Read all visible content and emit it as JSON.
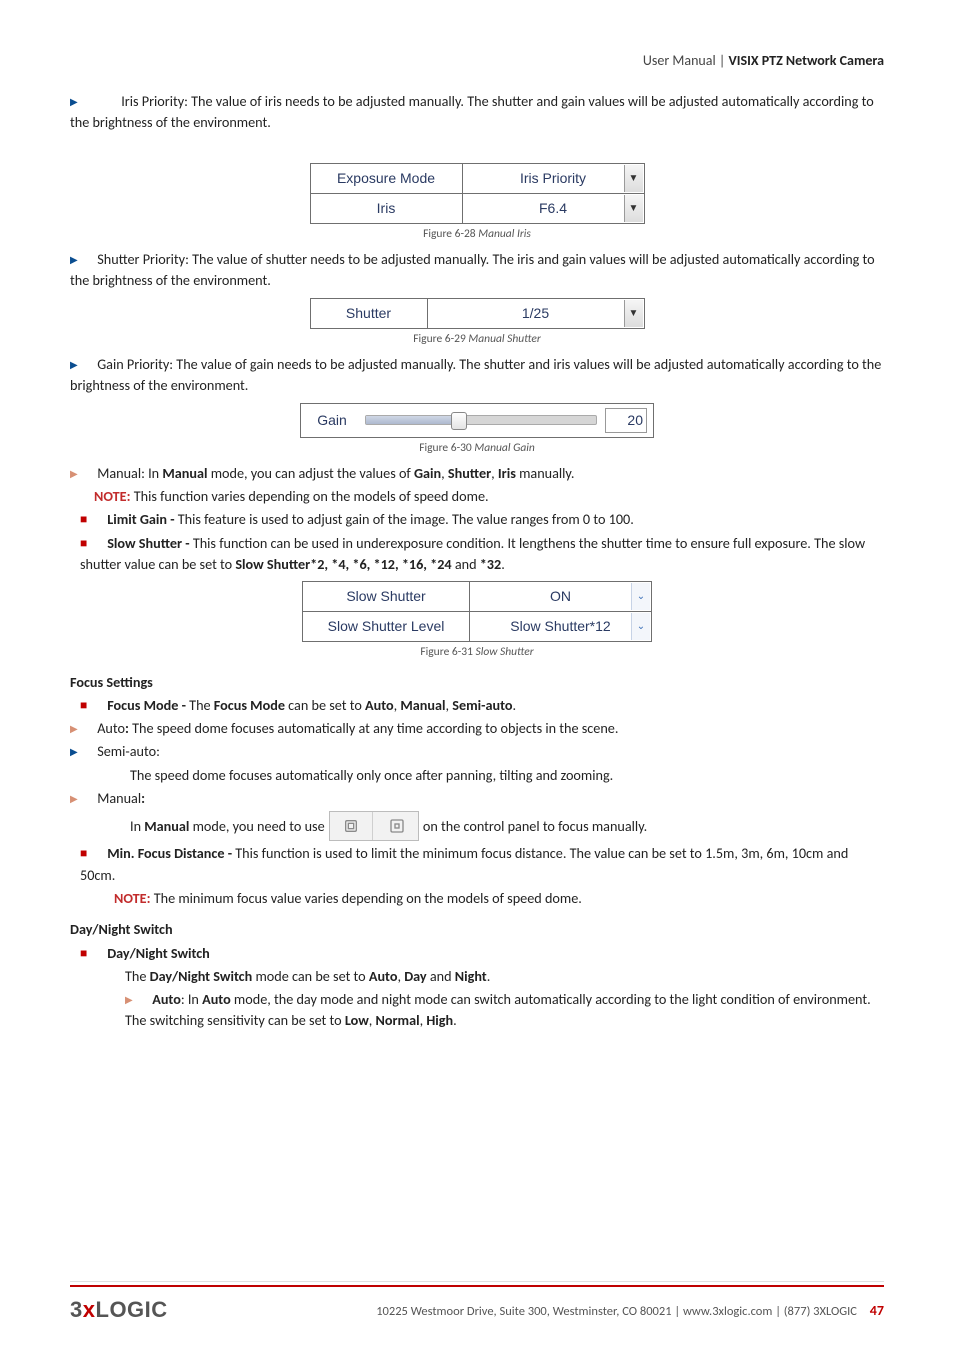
{
  "header": {
    "left": "User Manual",
    "sep": " | ",
    "right": "VISIX PTZ Network Camera"
  },
  "iris_priority": {
    "intro": "Iris Priority: The value of iris needs to be adjusted manually. The shutter and gain values will be adjusted automatically according to the brightness of the environment.",
    "row1_label": "Exposure Mode",
    "row1_value": "Iris Priority",
    "row2_label": "Iris",
    "row2_value": "F6.4",
    "caption_prefix": "Figure 6-28  ",
    "caption_ital": "Manual Iris"
  },
  "shutter_priority": {
    "intro": "Shutter Priority: The value of shutter needs to be adjusted manually. The iris and gain values will be adjusted automatically according to the brightness of the environment.",
    "row1_label": "Shutter",
    "row1_value": "1/25",
    "caption_prefix": "Figure 6-29  ",
    "caption_ital": "Manual Shutter"
  },
  "gain_priority": {
    "intro": "Gain Priority: The value of gain needs to be adjusted manually. The shutter and iris values will be adjusted automatically according to the brightness of the environment.",
    "slider_label": "Gain",
    "slider_value": "20",
    "caption_prefix": "Figure 6-30  ",
    "caption_ital": "Manual Gain"
  },
  "manual_item": {
    "pre": "Manual: In ",
    "b1": "Manual",
    "mid1": " mode, you can adjust the values of ",
    "b2": "Gain",
    "c1": ", ",
    "b3": "Shutter",
    "c2": ", ",
    "b4": "Iris",
    "post": " manually."
  },
  "manual_note": {
    "label": "NOTE:",
    "text": " This function varies depending on the models of speed dome."
  },
  "limit_gain": {
    "b": "Limit Gain - ",
    "text": "This feature is used to adjust gain of the image. The value ranges from 0 to 100."
  },
  "slow_shutter": {
    "b": "Slow Shutter - ",
    "text": "This function can be used in underexposure condition. It lengthens the shutter time to ensure full exposure. The slow shutter value can be set to ",
    "b2": "Slow Shutter*2, *4, *6, *12, *16, *24",
    "and": " and ",
    "b3": "*32",
    "period": ".",
    "row1_label": "Slow Shutter",
    "row1_value": "ON",
    "row2_label": "Slow Shutter Level",
    "row2_value": "Slow Shutter*12",
    "caption_prefix": "Figure 6-31  ",
    "caption_ital": "Slow Shutter"
  },
  "focus_settings": {
    "heading": "Focus Settings",
    "mode_b": "Focus Mode - ",
    "mode_pre": "The ",
    "mode_b2": "Focus Mode",
    "mode_mid": " can be set to ",
    "mode_o1": "Auto",
    "mode_c1": ", ",
    "mode_o2": "Manual",
    "mode_c2": ", ",
    "mode_o3": "Semi-auto",
    "mode_end": ".",
    "auto_pre": "Auto",
    "auto_colon": ":   ",
    "auto_text": "The speed dome focuses automatically at any time according to objects in the scene.",
    "semi_label": "Semi-auto:",
    "semi_text": "The speed dome focuses automatically only once after panning, tilting and zooming.",
    "manual_label": "Manual",
    "manual_colon": ":",
    "manual_pre": "In ",
    "manual_b": "Manual",
    "manual_mid": " mode, you need to use ",
    "manual_post": " on the control panel to focus manually.",
    "min_b": "Min. Focus Distance - ",
    "min_text": "This function is used to limit the minimum focus distance. The value can be set to 1.5m, 3m, 6m, 10cm and 50cm.",
    "min_note_label": "NOTE:",
    "min_note_text": " The minimum focus value varies depending on the models of speed dome."
  },
  "day_night": {
    "heading": "Day/Night Switch",
    "item_b": "Day/Night Switch",
    "line_pre": "The ",
    "line_b": "Day/Night Switch",
    "line_mid": " mode can be set to ",
    "line_o1": "Auto",
    "line_c1": ", ",
    "line_o2": "Day",
    "line_and": " and ",
    "line_o3": "Night",
    "line_end": ".",
    "auto_b": "Auto",
    "auto_colon": ":   In ",
    "auto_b2": "Auto",
    "auto_mid": " mode, the day mode and night mode can switch automatically according to the light condition of environment. The switching sensitivity can be set to ",
    "auto_o1": "Low",
    "auto_c1": ", ",
    "auto_o2": "Normal",
    "auto_c2": ", ",
    "auto_o3": "High",
    "auto_end": "."
  },
  "footer": {
    "logo_pre": "3",
    "logo_x": "x",
    "logo_post": "LOGIC",
    "text": "10225 Westmoor Drive, Suite 300, Westminster, CO 80021 | www.3xlogic.com | (877) 3XLOGIC",
    "page": "47"
  }
}
